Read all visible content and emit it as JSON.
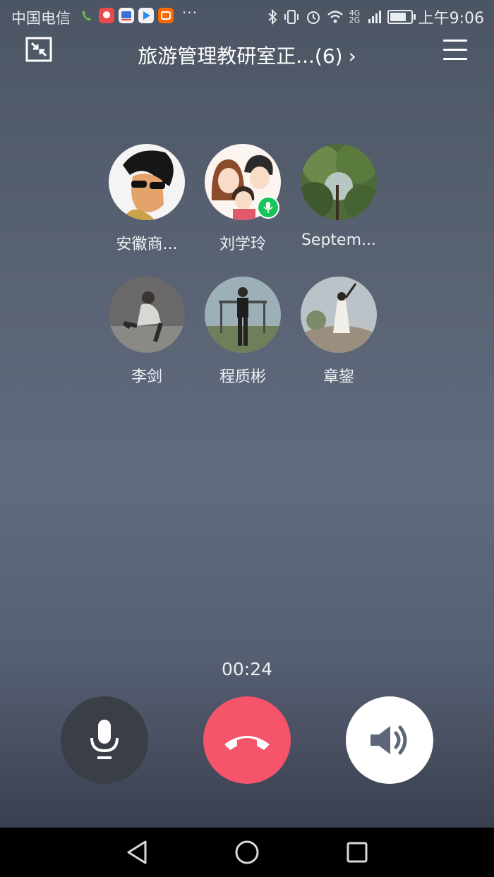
{
  "status_bar": {
    "carrier": "中国电信",
    "more": "···",
    "network": "4G 2G",
    "time": "上午9:06",
    "battery_level": 0.7
  },
  "header": {
    "title": "旅游管理教研室正...(6)",
    "chevron": "›",
    "minimize_icon": "minimize-window-icon",
    "menu_icon": "menu-icon"
  },
  "participants": [
    {
      "name": "安徽商...",
      "speaking": false
    },
    {
      "name": "刘学玲",
      "speaking": true
    },
    {
      "name": "Septem...",
      "speaking": false
    },
    {
      "name": "李剑",
      "speaking": false
    },
    {
      "name": "程质彬",
      "speaking": false
    },
    {
      "name": "章鋆",
      "speaking": false
    }
  ],
  "call": {
    "duration": "00:24"
  },
  "controls": {
    "mute_icon": "microphone-icon",
    "hangup_icon": "phone-hangup-icon",
    "speaker_icon": "speaker-icon"
  },
  "colors": {
    "hangup": "#f5546b",
    "speaking_badge": "#19c45a",
    "mute_bg": "#3a3e47"
  },
  "nav_bar": {
    "back_icon": "back-triangle-icon",
    "home_icon": "home-circle-icon",
    "recent_icon": "recent-apps-icon"
  }
}
